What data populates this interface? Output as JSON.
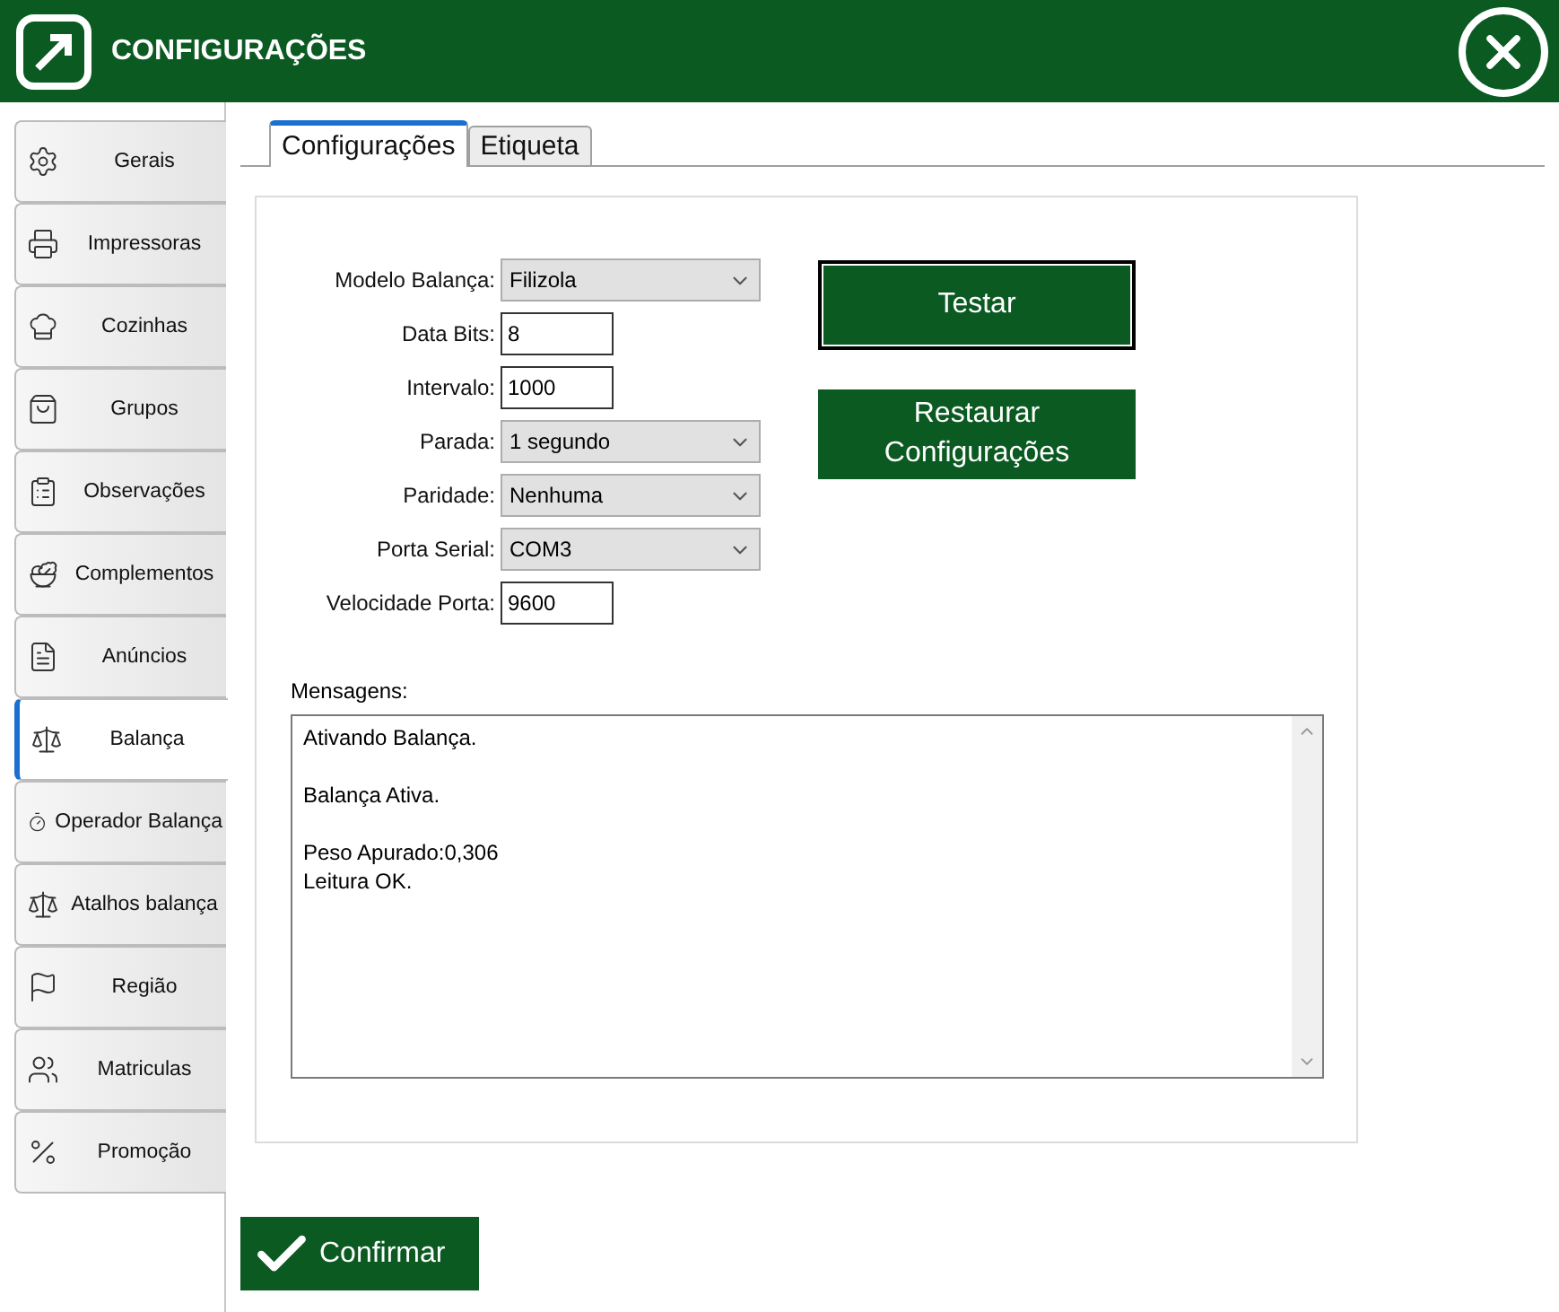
{
  "window": {
    "title": "CONFIGURAÇÕES"
  },
  "sidebar": {
    "items": [
      {
        "label": "Gerais",
        "selected": false
      },
      {
        "label": "Impressoras",
        "selected": false
      },
      {
        "label": "Cozinhas",
        "selected": false
      },
      {
        "label": "Grupos",
        "selected": false
      },
      {
        "label": "Observações",
        "selected": false
      },
      {
        "label": "Complementos",
        "selected": false
      },
      {
        "label": "Anúncios",
        "selected": false
      },
      {
        "label": "Balança",
        "selected": true
      },
      {
        "label": "Operador  Balança",
        "selected": false
      },
      {
        "label": "Atalhos balança",
        "selected": false
      },
      {
        "label": "Região",
        "selected": false
      },
      {
        "label": "Matriculas",
        "selected": false
      },
      {
        "label": "Promoção",
        "selected": false
      }
    ]
  },
  "tabs": [
    {
      "label": "Configurações",
      "selected": true
    },
    {
      "label": "Etiqueta",
      "selected": false
    }
  ],
  "form": [
    {
      "kind": "select",
      "label": "Modelo Balança:",
      "value": "Filizola"
    },
    {
      "kind": "input",
      "label": "Data Bits:",
      "value": "8"
    },
    {
      "kind": "input",
      "label": "Intervalo:",
      "value": "1000"
    },
    {
      "kind": "select",
      "label": "Parada:",
      "value": "1 segundo"
    },
    {
      "kind": "select",
      "label": "Paridade:",
      "value": "Nenhuma"
    },
    {
      "kind": "select",
      "label": "Porta Serial:",
      "value": "COM3"
    },
    {
      "kind": "input",
      "label": "Velocidade Porta:",
      "value": "9600"
    }
  ],
  "actions": [
    {
      "label": "Testar",
      "focused": true
    },
    {
      "label": "Restaurar Configurações",
      "focused": false
    }
  ],
  "messages": {
    "label": "Mensagens:",
    "text": "Ativando Balança.\n\nBalança Ativa.\n\nPeso Apurado:0,306\nLeitura OK."
  },
  "confirm_button": {
    "label": "Confirmar"
  }
}
